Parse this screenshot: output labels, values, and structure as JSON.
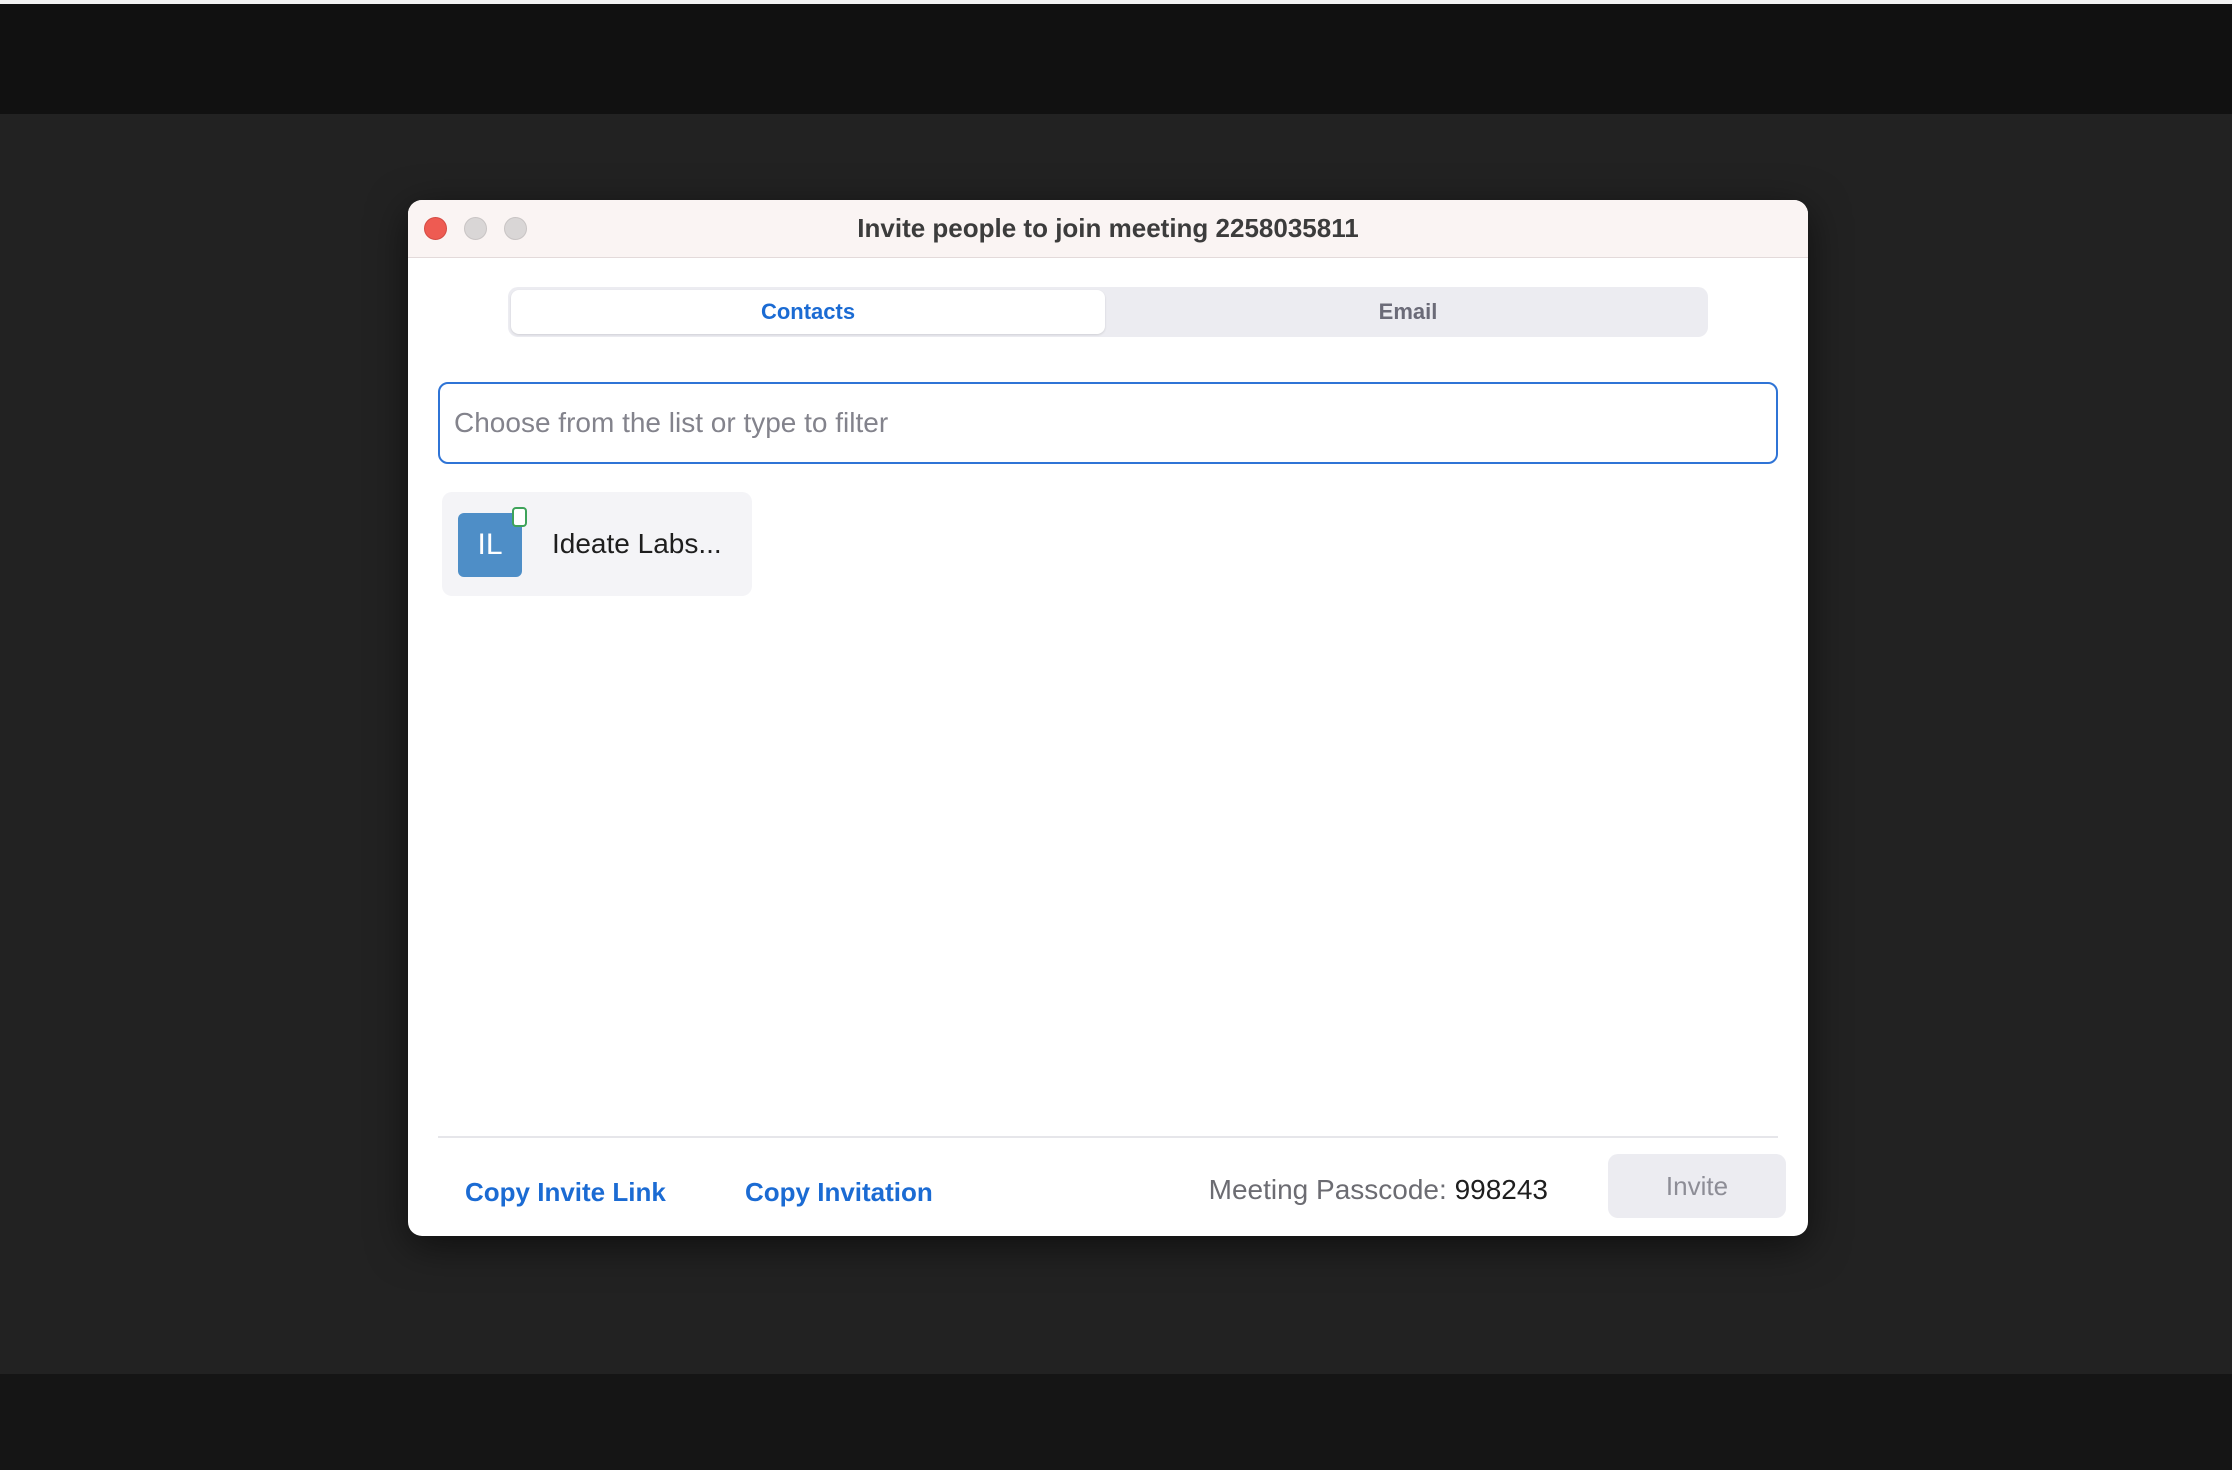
{
  "dialog": {
    "title": "Invite people to join meeting 2258035811"
  },
  "tabs": [
    {
      "label": "Contacts",
      "active": true
    },
    {
      "label": "Email",
      "active": false
    }
  ],
  "search": {
    "placeholder": "Choose from the list or type to filter",
    "value": ""
  },
  "contacts": [
    {
      "initials": "IL",
      "name": "Ideate Labs...",
      "status": "online",
      "avatar_color": "#4e8ec7"
    }
  ],
  "footer": {
    "copy_invite_link": "Copy Invite Link",
    "copy_invitation": "Copy Invitation",
    "passcode_label": "Meeting Passcode:",
    "passcode_value": "998243",
    "invite_button": "Invite"
  },
  "colors": {
    "accent": "#1b6bd3",
    "close_button": "#ee5b52",
    "background": "#222222"
  }
}
